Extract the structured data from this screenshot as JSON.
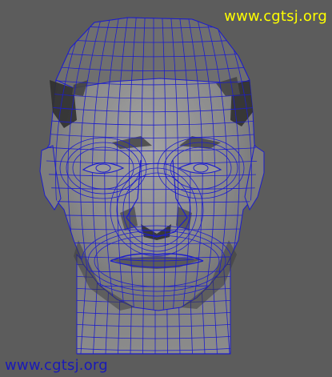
{
  "viewport": {
    "background": "#5c5c5c",
    "wire_color": "#1d1dcc",
    "shade_light": "#8a8a8a",
    "shade_dark": "#2d2d2d"
  },
  "watermarks": {
    "top": {
      "text": "www.cgtsj.org",
      "color": "#ffff00"
    },
    "bottom": {
      "text": "www.cgtsj.org",
      "color": "#1a1ab8"
    }
  },
  "model": {
    "icon": "wireframe-head-mesh"
  }
}
